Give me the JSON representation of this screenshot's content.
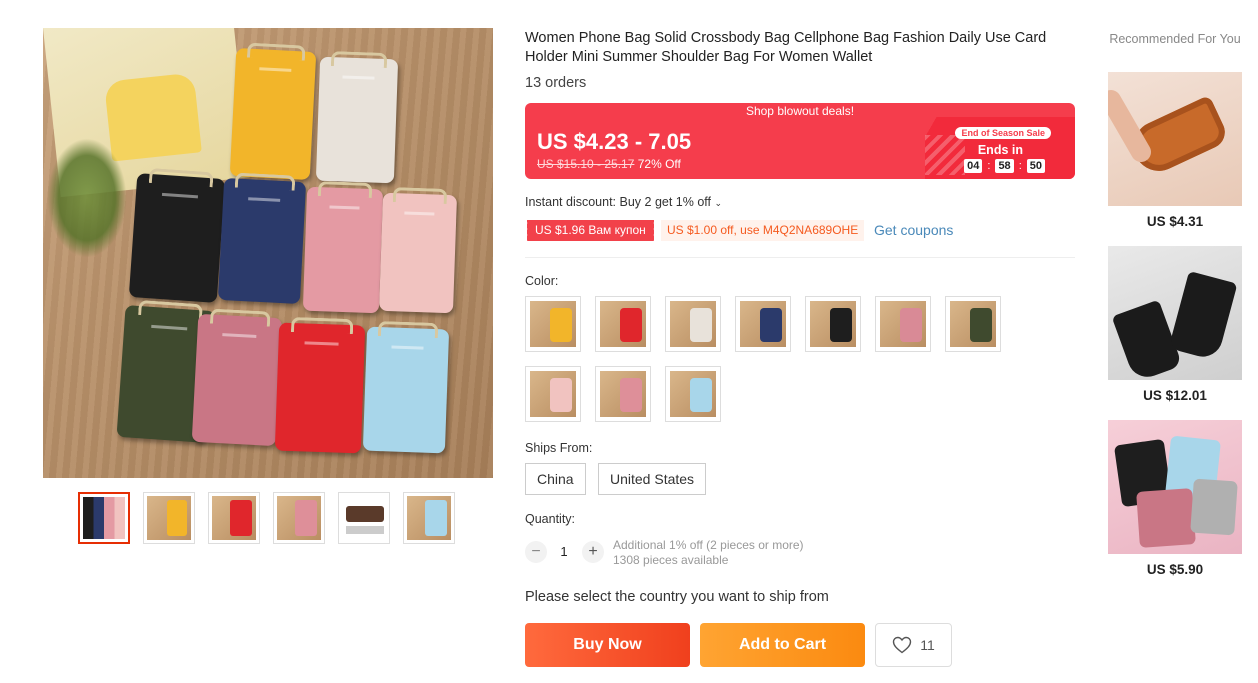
{
  "product": {
    "title": "Women Phone Bag Solid Crossbody Bag Cellphone Bag Fashion Daily Use Card Holder Mini Summer Shoulder Bag For Women Wallet",
    "orders": "13 orders"
  },
  "gallery": {
    "thumbnails": [
      "thumb-1",
      "thumb-2",
      "thumb-3",
      "thumb-4",
      "thumb-5",
      "thumb-6"
    ]
  },
  "deal": {
    "banner": "Shop blowout deals!",
    "price_range": "US $4.23 - 7.05",
    "original_price": "US $15.10 - 25.17",
    "discount": "72% Off",
    "event_label": "End of Season Sale",
    "ends_in_label": "Ends in",
    "timer": {
      "hours": "04",
      "minutes": "58",
      "seconds": "50"
    },
    "accent_color": "#f53d4c"
  },
  "discounts": {
    "instant": "Instant discount: Buy 2 get 1% off",
    "coupon_red": "US $1.96 Вам купон",
    "coupon_orange": "US $1.00 off, use M4Q2NA689OHE",
    "get_coupons": "Get coupons"
  },
  "color": {
    "label": "Color:",
    "options": [
      "#f2b52a",
      "#e0262c",
      "#e8e2da",
      "#2b3a6b",
      "#1e1e1e",
      "#d98a96",
      "#3f4a2e",
      "#f1c3c0",
      "#de8f99",
      "#a8d6ea"
    ]
  },
  "ships_from": {
    "label": "Ships From:",
    "options": [
      "China",
      "United States"
    ]
  },
  "quantity": {
    "label": "Quantity:",
    "value": "1",
    "minus": "−",
    "plus": "+",
    "additional": "Additional 1% off (2 pieces or more)",
    "available": "1308 pieces available"
  },
  "ship_message": "Please select the country you want to ship from",
  "actions": {
    "buy_now": "Buy Now",
    "add_to_cart": "Add to Cart",
    "wishlist_count": "11"
  },
  "recommended": {
    "title": "Recommended For You",
    "items": [
      {
        "price": "US $4.31",
        "icon": "sandal"
      },
      {
        "price": "US $12.01",
        "icon": "ankle-boot"
      },
      {
        "price": "US $5.90",
        "icon": "phone-bag"
      }
    ]
  }
}
